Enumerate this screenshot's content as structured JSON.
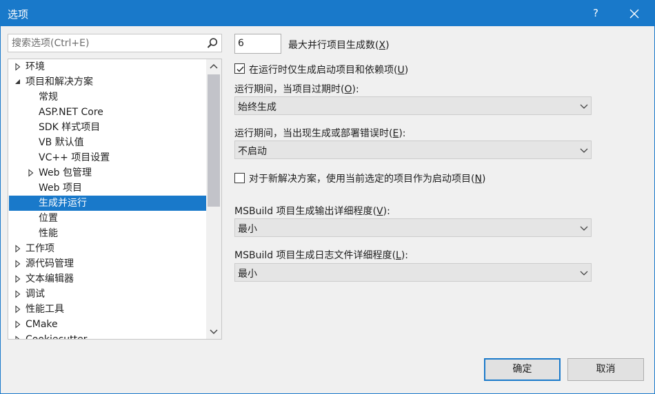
{
  "window": {
    "title": "选项",
    "help": "?"
  },
  "search": {
    "placeholder": "搜索选项(Ctrl+E)"
  },
  "tree": [
    {
      "label": "环境",
      "expanded": false
    },
    {
      "label": "项目和解决方案",
      "expanded": true
    },
    {
      "label": "常规"
    },
    {
      "label": "ASP.NET Core"
    },
    {
      "label": "SDK 样式项目"
    },
    {
      "label": "VB 默认值"
    },
    {
      "label": "VC++ 项目设置"
    },
    {
      "label": "Web 包管理",
      "expanded": false
    },
    {
      "label": "Web 项目"
    },
    {
      "label": "生成并运行",
      "selected": true
    },
    {
      "label": "位置"
    },
    {
      "label": "性能"
    },
    {
      "label": "工作项",
      "expanded": false
    },
    {
      "label": "源代码管理",
      "expanded": false
    },
    {
      "label": "文本编辑器",
      "expanded": false
    },
    {
      "label": "调试",
      "expanded": false
    },
    {
      "label": "性能工具",
      "expanded": false
    },
    {
      "label": "CMake",
      "expanded": false
    },
    {
      "label": "Cookiecutter",
      "expanded": false
    }
  ],
  "settings": {
    "max_parallel_value": "6",
    "max_parallel_label": "最大并行项目生成数",
    "max_parallel_key": "X",
    "build_startup_label": "在运行时仅生成启动项目和依赖项",
    "build_startup_key": "U",
    "build_startup_checked": true,
    "outdated_label": "运行期间，当项目过期时",
    "outdated_key": "O",
    "outdated_value": "始终生成",
    "errors_label": "运行期间，当出现生成或部署错误时",
    "errors_key": "E",
    "errors_value": "不启动",
    "new_solution_label": "对于新解决方案，使用当前选定的项目作为启动项目",
    "new_solution_key": "N",
    "new_solution_checked": false,
    "msbuild_output_label": "MSBuild 项目生成输出详细程度",
    "msbuild_output_key": "V",
    "msbuild_output_value": "最小",
    "msbuild_log_label": "MSBuild 项目生成日志文件详细程度",
    "msbuild_log_key": "L",
    "msbuild_log_value": "最小"
  },
  "buttons": {
    "ok": "确定",
    "cancel": "取消"
  },
  "colors": {
    "accent": "#1979ca",
    "selected_text": "#ffffff"
  }
}
